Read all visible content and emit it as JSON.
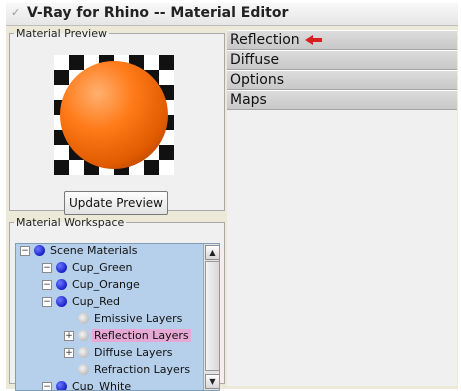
{
  "window": {
    "title": "V-Ray for Rhino -- Material Editor",
    "title_icon": "vray-icon"
  },
  "preview": {
    "group_label": "Material Preview",
    "update_button": "Update Preview"
  },
  "workspace": {
    "group_label": "Material Workspace",
    "items": [
      {
        "label": "Scene Materials",
        "icon": "blue-sphere-icon",
        "expander": "−",
        "selected": false
      },
      {
        "label": "Cup_Green",
        "icon": "blue-sphere-icon",
        "expander": "−",
        "selected": false
      },
      {
        "label": "Cup_Orange",
        "icon": "blue-sphere-icon",
        "expander": "−",
        "selected": false
      },
      {
        "label": "Cup_Red",
        "icon": "blue-sphere-icon",
        "expander": "−",
        "selected": false
      },
      {
        "label": "Emissive Layers",
        "icon": "layer-icon",
        "expander": "",
        "selected": false
      },
      {
        "label": "Reflection Layers",
        "icon": "layer-icon",
        "expander": "+",
        "selected": true
      },
      {
        "label": "Diffuse Layers",
        "icon": "layer-icon",
        "expander": "+",
        "selected": false
      },
      {
        "label": "Refraction Layers",
        "icon": "layer-icon",
        "expander": "",
        "selected": false
      },
      {
        "label": "Cup_White",
        "icon": "blue-sphere-icon",
        "expander": "−",
        "selected": false
      }
    ]
  },
  "rollouts": [
    {
      "label": "Reflection",
      "annotated": true,
      "annotation_color": "#d81e1e"
    },
    {
      "label": "Diffuse",
      "annotated": false
    },
    {
      "label": "Options",
      "annotated": false
    },
    {
      "label": "Maps",
      "annotated": false
    }
  ],
  "colors": {
    "preview_sphere": "#ff7a18",
    "selection_highlight": "#e7a8d6",
    "tree_background": "#b6d0ec"
  }
}
